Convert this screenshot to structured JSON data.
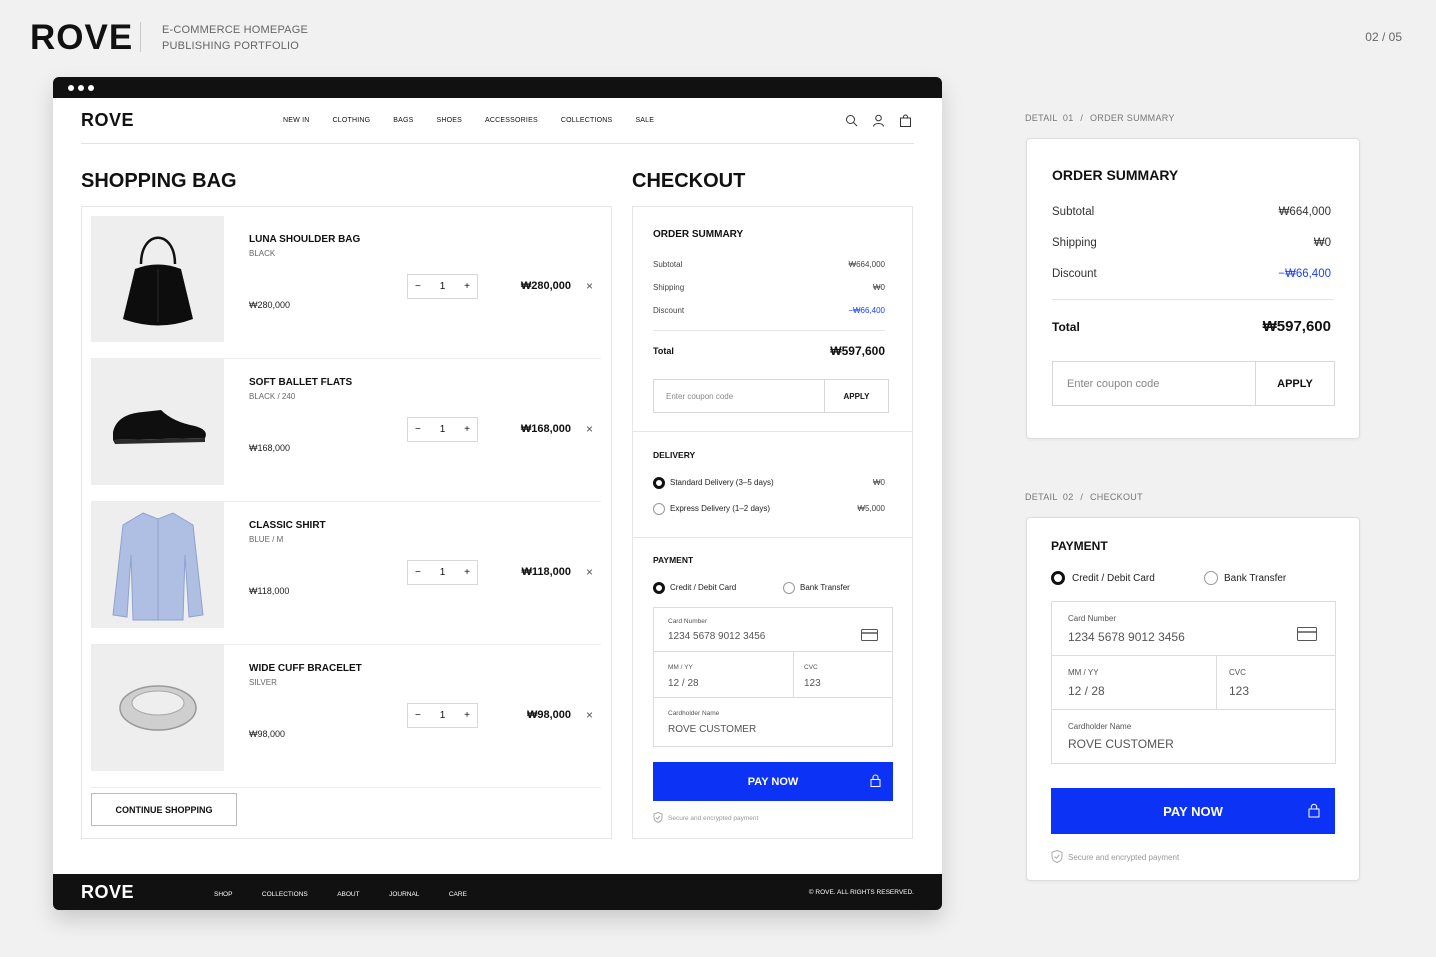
{
  "portfolio": {
    "logo": "ROVE",
    "subtitle_line1": "E-COMMERCE HOMEPAGE",
    "subtitle_line2": "PUBLISHING PORTFOLIO",
    "page_indicator": "02 / 05"
  },
  "site": {
    "logo": "ROVE",
    "nav": [
      "NEW IN",
      "CLOTHING",
      "BAGS",
      "SHOES",
      "ACCESSORIES",
      "COLLECTIONS",
      "SALE"
    ],
    "icons": [
      "search-icon",
      "user-icon",
      "bag-icon"
    ]
  },
  "bag": {
    "title": "SHOPPING BAG",
    "items": [
      {
        "name": "LUNA SHOULDER BAG",
        "variant": "BLACK",
        "price": "₩280,000",
        "qty": "1",
        "total": "₩280,000",
        "image": "handbag"
      },
      {
        "name": "SOFT BALLET FLATS",
        "variant": "BLACK / 240",
        "price": "₩168,000",
        "qty": "1",
        "total": "₩168,000",
        "image": "shoe"
      },
      {
        "name": "CLASSIC SHIRT",
        "variant": "BLUE / M",
        "price": "₩118,000",
        "qty": "1",
        "total": "₩118,000",
        "image": "shirt"
      },
      {
        "name": "WIDE CUFF BRACELET",
        "variant": "SILVER",
        "price": "₩98,000",
        "qty": "1",
        "total": "₩98,000",
        "image": "bracelet"
      }
    ],
    "continue_label": "CONTINUE SHOPPING",
    "minus": "−",
    "plus": "+",
    "remove": "×"
  },
  "checkout": {
    "title": "CHECKOUT",
    "summary": {
      "title": "ORDER SUMMARY",
      "subtotal_label": "Subtotal",
      "subtotal": "₩664,000",
      "shipping_label": "Shipping",
      "shipping": "₩0",
      "discount_label": "Discount",
      "discount": "−₩66,400",
      "total_label": "Total",
      "total": "₩597,600",
      "coupon_placeholder": "Enter coupon code",
      "apply_label": "APPLY"
    },
    "delivery": {
      "title": "DELIVERY",
      "options": [
        {
          "label": "Standard Delivery (3–5 days)",
          "price": "₩0",
          "selected": true
        },
        {
          "label": "Express Delivery (1–2 days)",
          "price": "₩5,000",
          "selected": false
        }
      ]
    },
    "payment": {
      "title": "PAYMENT",
      "methods": [
        {
          "label": "Credit / Debit Card",
          "selected": true
        },
        {
          "label": "Bank Transfer",
          "selected": false
        }
      ],
      "card_number_label": "Card Number",
      "card_number": "1234 5678 9012 3456",
      "expiry_label": "MM / YY",
      "expiry": "12 / 28",
      "cvc_label": "CVC",
      "cvc": "123",
      "holder_label": "Cardholder Name",
      "holder": "ROVE CUSTOMER",
      "pay_label": "PAY NOW",
      "secure_text": "Secure and encrypted payment"
    }
  },
  "footer": {
    "logo": "ROVE",
    "links": [
      "SHOP",
      "COLLECTIONS",
      "ABOUT",
      "JOURNAL",
      "CARE"
    ],
    "copyright": "© ROVE. ALL RIGHTS RESERVED."
  },
  "details": {
    "detail1": {
      "num": "DETAIL  01",
      "sep": "/",
      "name": "ORDER SUMMARY"
    },
    "detail2": {
      "num": "DETAIL  02",
      "sep": "/",
      "name": "CHECKOUT"
    }
  },
  "colors": {
    "accent": "#0b32f5",
    "discount": "#1a3fff",
    "dark": "#111111",
    "page_bg": "#f1f1f1"
  }
}
